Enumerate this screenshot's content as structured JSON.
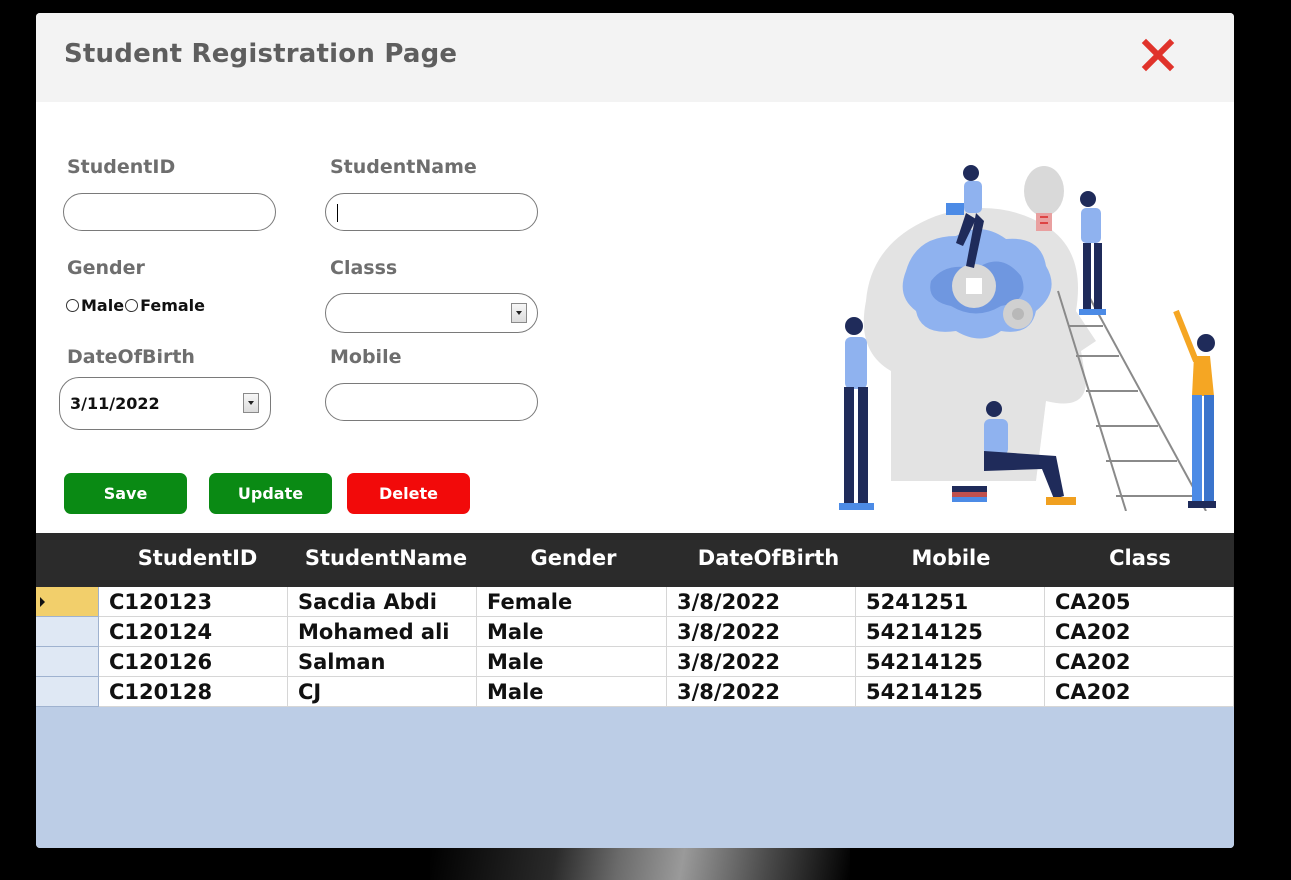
{
  "window": {
    "title": "Student Registration Page"
  },
  "form": {
    "student_id": {
      "label": "StudentID",
      "value": ""
    },
    "student_name": {
      "label": "StudentName",
      "value": ""
    },
    "gender": {
      "label": "Gender",
      "options": [
        "Male",
        "Female"
      ],
      "selected": null
    },
    "classs": {
      "label": "Classs",
      "value": ""
    },
    "date_of_birth": {
      "label": "DateOfBirth",
      "value": "3/11/2022"
    },
    "mobile": {
      "label": "Mobile",
      "value": ""
    }
  },
  "buttons": {
    "save": "Save",
    "update": "Update",
    "delete": "Delete"
  },
  "colors": {
    "save": "#0a8a14",
    "update": "#0a8a14",
    "delete": "#f20a0a",
    "close": "#e0332b",
    "grid_header": "#2b2b2b",
    "grid_background": "#bccde6",
    "selected_row_header": "#f2cf6b"
  },
  "grid": {
    "columns": [
      "StudentID",
      "StudentName",
      "Gender",
      "DateOfBirth",
      "Mobile",
      "Class"
    ],
    "rows": [
      [
        "C120123",
        "Sacdia Abdi",
        "Female",
        "3/8/2022",
        "5241251",
        "CA205"
      ],
      [
        "C120124",
        "Mohamed ali",
        "Male",
        "3/8/2022",
        "54214125",
        "CA202"
      ],
      [
        "C120126",
        "Salman",
        "Male",
        "3/8/2022",
        "54214125",
        "CA202"
      ],
      [
        "C120128",
        "CJ",
        "Male",
        "3/8/2022",
        "54214125",
        "CA202"
      ]
    ],
    "selected_row": 0
  },
  "icons": {
    "close": "close-icon",
    "dropdown": "chevron-down-icon",
    "row_indicator": "row-pointer-icon",
    "illustration": "team-brainstorm-illustration"
  }
}
